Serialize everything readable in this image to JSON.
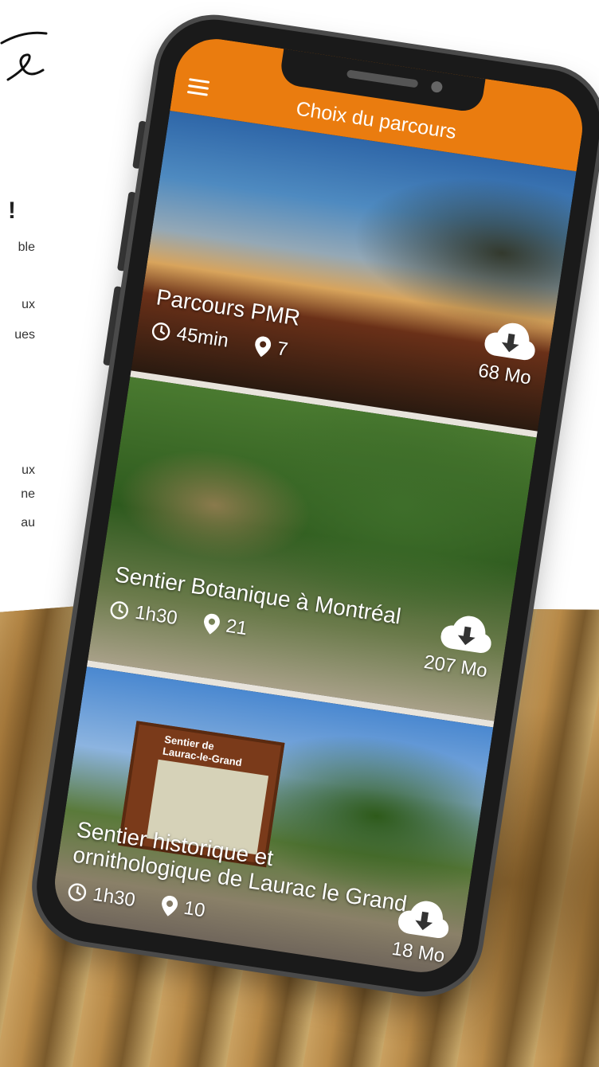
{
  "left_fragments": [
    "ble",
    "ux",
    "ues",
    "ux",
    "ne",
    "au"
  ],
  "headline_mark": "!",
  "app": {
    "title": "Choix du parcours",
    "accent_color": "#ea7c0f",
    "menu_icon": "hamburger-icon"
  },
  "routes": [
    {
      "title_lines": [
        "Parcours PMR"
      ],
      "duration": "45min",
      "stops": "7",
      "size": "68 Mo"
    },
    {
      "title_lines": [
        "Sentier Botanique à Montréal"
      ],
      "duration": "1h30",
      "stops": "21",
      "size": "207 Mo"
    },
    {
      "title_lines": [
        "Sentier historique et",
        "ornithologique de Laurac le Grand"
      ],
      "duration": "1h30",
      "stops": "10",
      "size": "18 Mo",
      "sign_lines": [
        "Sentier de",
        "Laurac-le-Grand"
      ]
    }
  ]
}
